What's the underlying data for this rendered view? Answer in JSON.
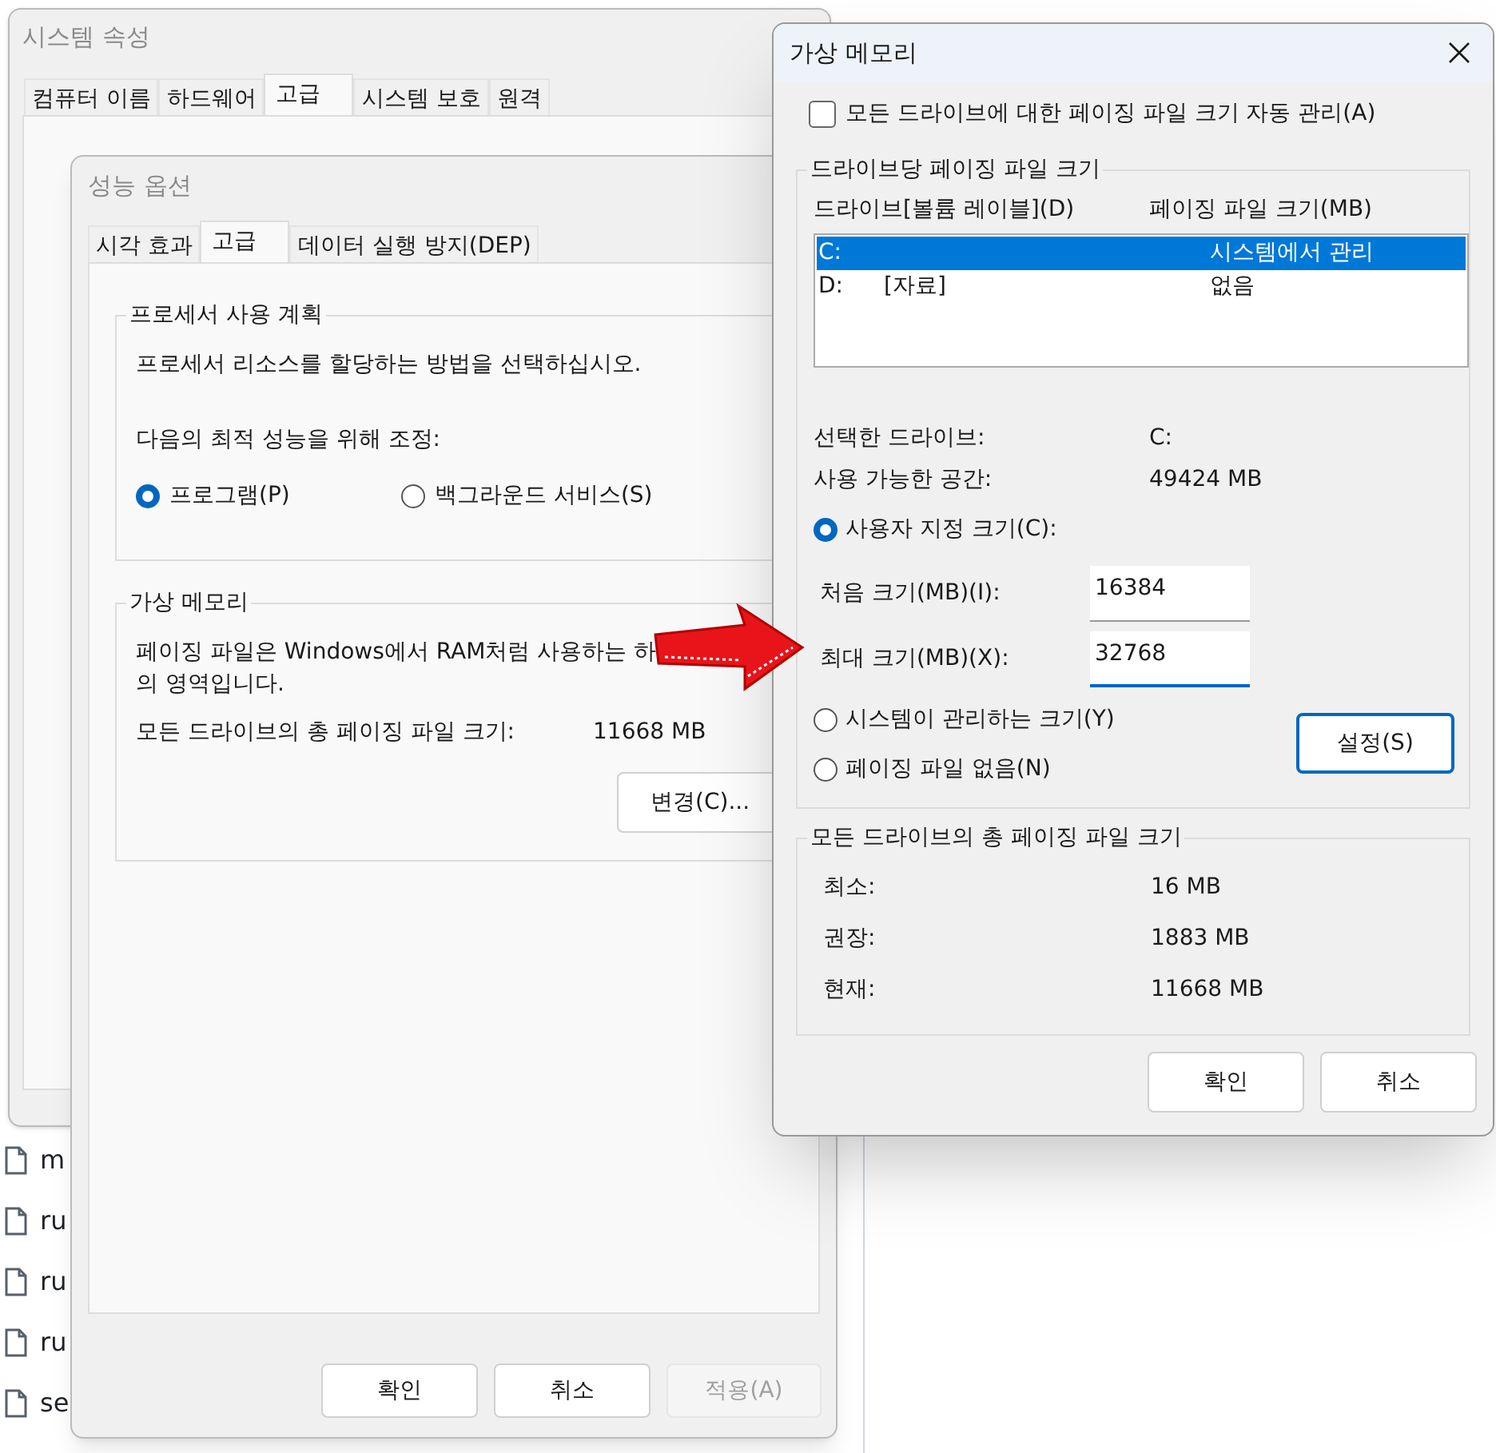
{
  "system_properties": {
    "title": "시스템 속성",
    "tabs": [
      {
        "label": "컴퓨터 이름",
        "selected": false
      },
      {
        "label": "하드웨어",
        "selected": false
      },
      {
        "label": "고급",
        "selected": true
      },
      {
        "label": "시스템 보호",
        "selected": false
      },
      {
        "label": "원격",
        "selected": false
      }
    ]
  },
  "background_files": [
    "m",
    "ru",
    "ru",
    "ru",
    "se"
  ],
  "performance_options": {
    "title": "성능 옵션",
    "tabs": [
      {
        "label": "시각 효과",
        "selected": false
      },
      {
        "label": "고급",
        "selected": true
      },
      {
        "label": "데이터 실행 방지(DEP)",
        "selected": false
      }
    ],
    "processor_group": {
      "title": "프로세서 사용 계획",
      "description": "프로세서 리소스를 할당하는 방법을 선택하십시오.",
      "adjust_label": "다음의 최적 성능을 위해 조정:",
      "options": [
        {
          "label": "프로그램(P)",
          "selected": true
        },
        {
          "label": "백그라운드 서비스(S)",
          "selected": false
        }
      ]
    },
    "virtual_memory_group": {
      "title": "가상 메모리",
      "description_lines": [
        "페이징 파일은 Windows에서 RAM처럼 사용하는 하",
        "의 영역입니다."
      ],
      "total_label": "모든 드라이브의 총 페이징 파일 크기:",
      "total_value": "11668 MB",
      "change_button": "변경(C)..."
    },
    "buttons": [
      {
        "label": "확인",
        "disabled": false
      },
      {
        "label": "취소",
        "disabled": false
      },
      {
        "label": "적용(A)",
        "disabled": true
      }
    ]
  },
  "virtual_memory": {
    "title": "가상 메모리",
    "auto_manage": {
      "label": "모든 드라이브에 대한 페이징 파일 크기 자동 관리(A)",
      "checked": false
    },
    "per_drive_group": {
      "title": "드라이브당 페이징 파일 크기",
      "columns": [
        "드라이브[볼륨 레이블](D)",
        "페이징 파일 크기(MB)"
      ],
      "drives": [
        {
          "drive": "C:",
          "size": "시스템에서 관리",
          "selected": true
        },
        {
          "drive": "D:",
          "volume_label": "[자료]",
          "size": "없음",
          "selected": false
        }
      ],
      "selected_drive_label": "선택한 드라이브:",
      "selected_drive_value": "C:",
      "free_space_label": "사용 가능한 공간:",
      "free_space_value": "49424 MB",
      "size_options": [
        {
          "label": "사용자 지정 크기(C):",
          "selected": true
        },
        {
          "label": "시스템이 관리하는 크기(Y)",
          "selected": false
        },
        {
          "label": "페이징 파일 없음(N)",
          "selected": false
        }
      ],
      "initial_size": {
        "label": "처음 크기(MB)(I):",
        "value": "16384",
        "focused": false
      },
      "maximum_size": {
        "label": "최대 크기(MB)(X):",
        "value": "32768",
        "focused": true
      },
      "set_button": "설정(S)"
    },
    "totals_group": {
      "title": "모든 드라이브의 총 페이징 파일 크기",
      "rows": [
        {
          "label": "최소:",
          "value": "16 MB"
        },
        {
          "label": "권장:",
          "value": "1883 MB"
        },
        {
          "label": "현재:",
          "value": "11668 MB"
        }
      ]
    },
    "buttons": [
      "확인",
      "취소"
    ]
  }
}
